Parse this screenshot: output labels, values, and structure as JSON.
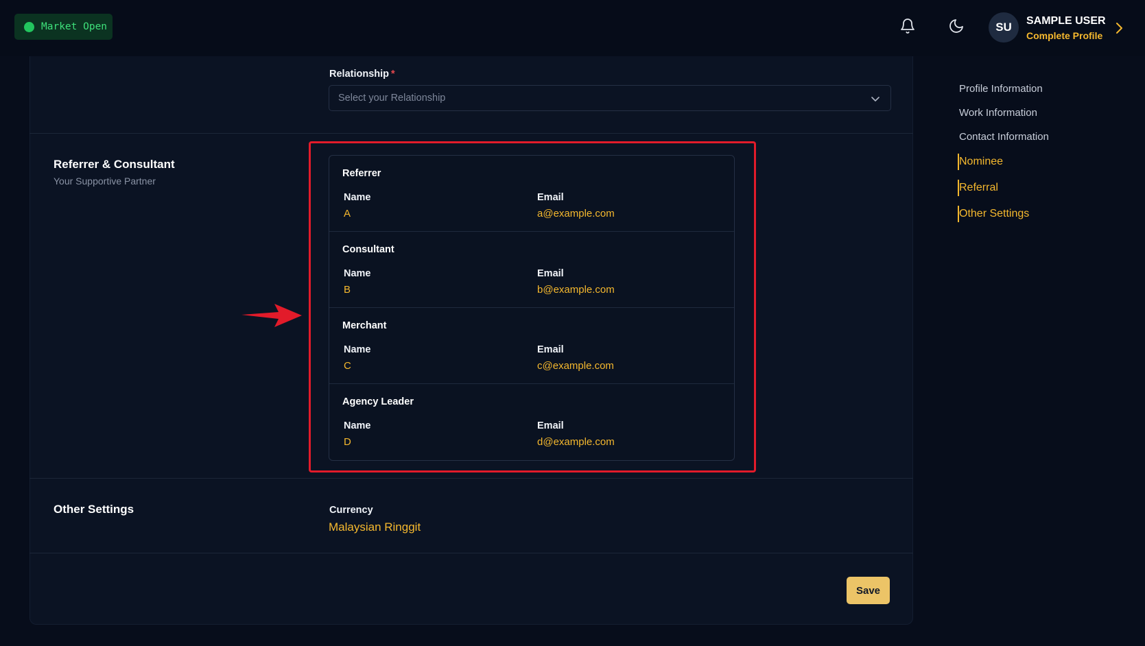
{
  "market": {
    "label": "Market Open"
  },
  "user": {
    "initials": "SU",
    "name": "SAMPLE USER",
    "subtitle": "Complete Profile"
  },
  "relationship": {
    "label": "Relationship",
    "required_mark": "*",
    "placeholder": "Select your Relationship"
  },
  "referrer_section": {
    "title": "Referrer & Consultant",
    "subtitle": "Your Supportive Partner",
    "entries": [
      {
        "title": "Referrer",
        "name_label": "Name",
        "email_label": "Email",
        "name": "A",
        "email": "a@example.com"
      },
      {
        "title": "Consultant",
        "name_label": "Name",
        "email_label": "Email",
        "name": "B",
        "email": "b@example.com"
      },
      {
        "title": "Merchant",
        "name_label": "Name",
        "email_label": "Email",
        "name": "C",
        "email": "c@example.com"
      },
      {
        "title": "Agency Leader",
        "name_label": "Name",
        "email_label": "Email",
        "name": "D",
        "email": "d@example.com"
      }
    ]
  },
  "other_settings": {
    "title": "Other Settings",
    "currency_label": "Currency",
    "currency_value": "Malaysian Ringgit"
  },
  "save_label": "Save",
  "toc": [
    {
      "label": "Profile Information",
      "active": false
    },
    {
      "label": "Work Information",
      "active": false
    },
    {
      "label": "Contact Information",
      "active": false
    },
    {
      "label": "Nominee",
      "active": true
    },
    {
      "label": "Referral",
      "active": true
    },
    {
      "label": "Other Settings",
      "active": true
    }
  ],
  "colors": {
    "accent": "#f5b82e",
    "highlight": "#e21b2a",
    "market_green": "#22c55e",
    "background": "#070d1b"
  }
}
